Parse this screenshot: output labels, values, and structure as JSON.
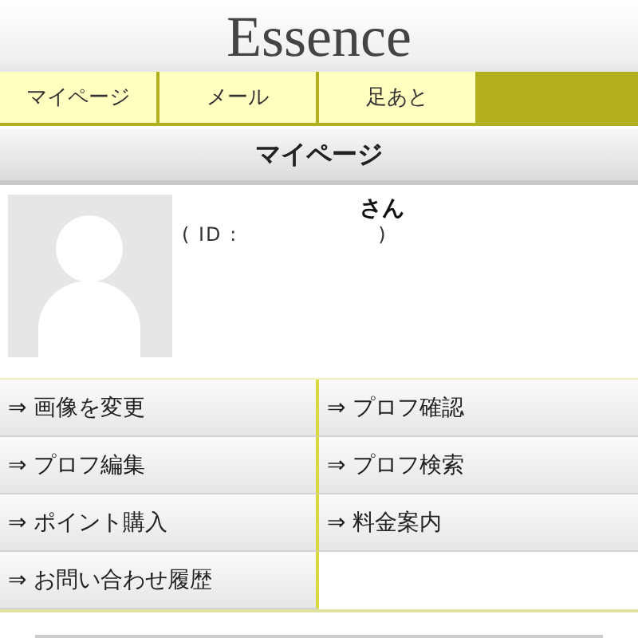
{
  "header": {
    "logo": "Essence"
  },
  "nav": {
    "tabs": [
      {
        "label": "マイページ"
      },
      {
        "label": "メール"
      },
      {
        "label": "足あと"
      }
    ]
  },
  "page_title": "マイページ",
  "profile": {
    "name": "さん",
    "id_open": "( ID :",
    "id_close": ")"
  },
  "menu": [
    {
      "label": "⇒ 画像を変更"
    },
    {
      "label": "⇒ プロフ確認"
    },
    {
      "label": "⇒ プロフ編集"
    },
    {
      "label": "⇒ プロフ検索"
    },
    {
      "label": "⇒ ポイント購入"
    },
    {
      "label": "⇒ 料金案内"
    },
    {
      "label": "⇒ お問い合わせ履歴"
    }
  ]
}
